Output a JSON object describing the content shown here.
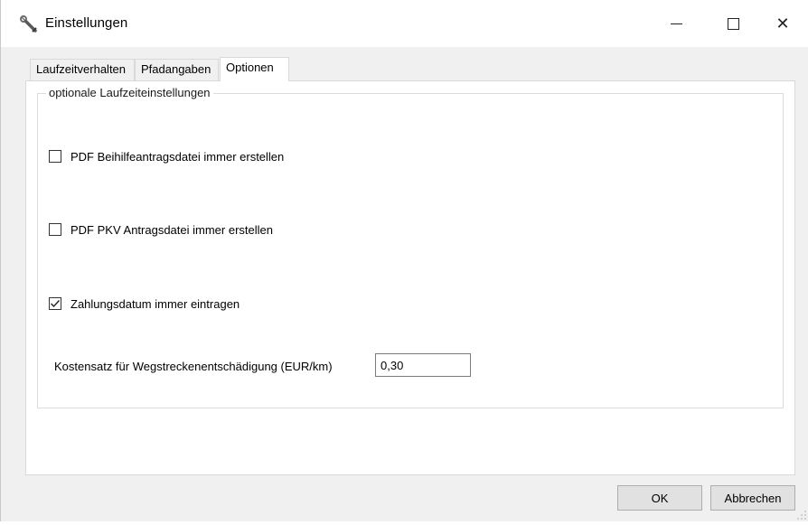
{
  "window": {
    "title": "Einstellungen",
    "app_icon": "wrench-icon",
    "controls": {
      "minimize_icon": "minimize-icon",
      "maximize_icon": "maximize-icon",
      "close_label": "✕"
    }
  },
  "tabs": [
    {
      "label": "Laufzeitverhalten",
      "selected": false
    },
    {
      "label": "Pfadangaben",
      "selected": false
    },
    {
      "label": "Optionen",
      "selected": true
    }
  ],
  "group": {
    "legend": "optionale Laufzeiteinstellungen",
    "options": [
      {
        "label": "PDF Beihilfeantragsdatei immer erstellen",
        "checked": false
      },
      {
        "label": "PDF PKV Antragsdatei immer erstellen",
        "checked": false
      },
      {
        "label": "Zahlungsdatum immer eintragen",
        "checked": true
      }
    ],
    "cost_rate": {
      "label": "Kostensatz für Wegstreckenentschädigung (EUR/km)",
      "value": "0,30"
    }
  },
  "buttons": {
    "ok_label": "OK",
    "cancel_label": "Abbrechen"
  },
  "colors": {
    "window_bg": "#f0f0f0",
    "page_bg": "#ffffff",
    "border": "#d9d9d9",
    "button_bg": "#e1e1e1"
  }
}
